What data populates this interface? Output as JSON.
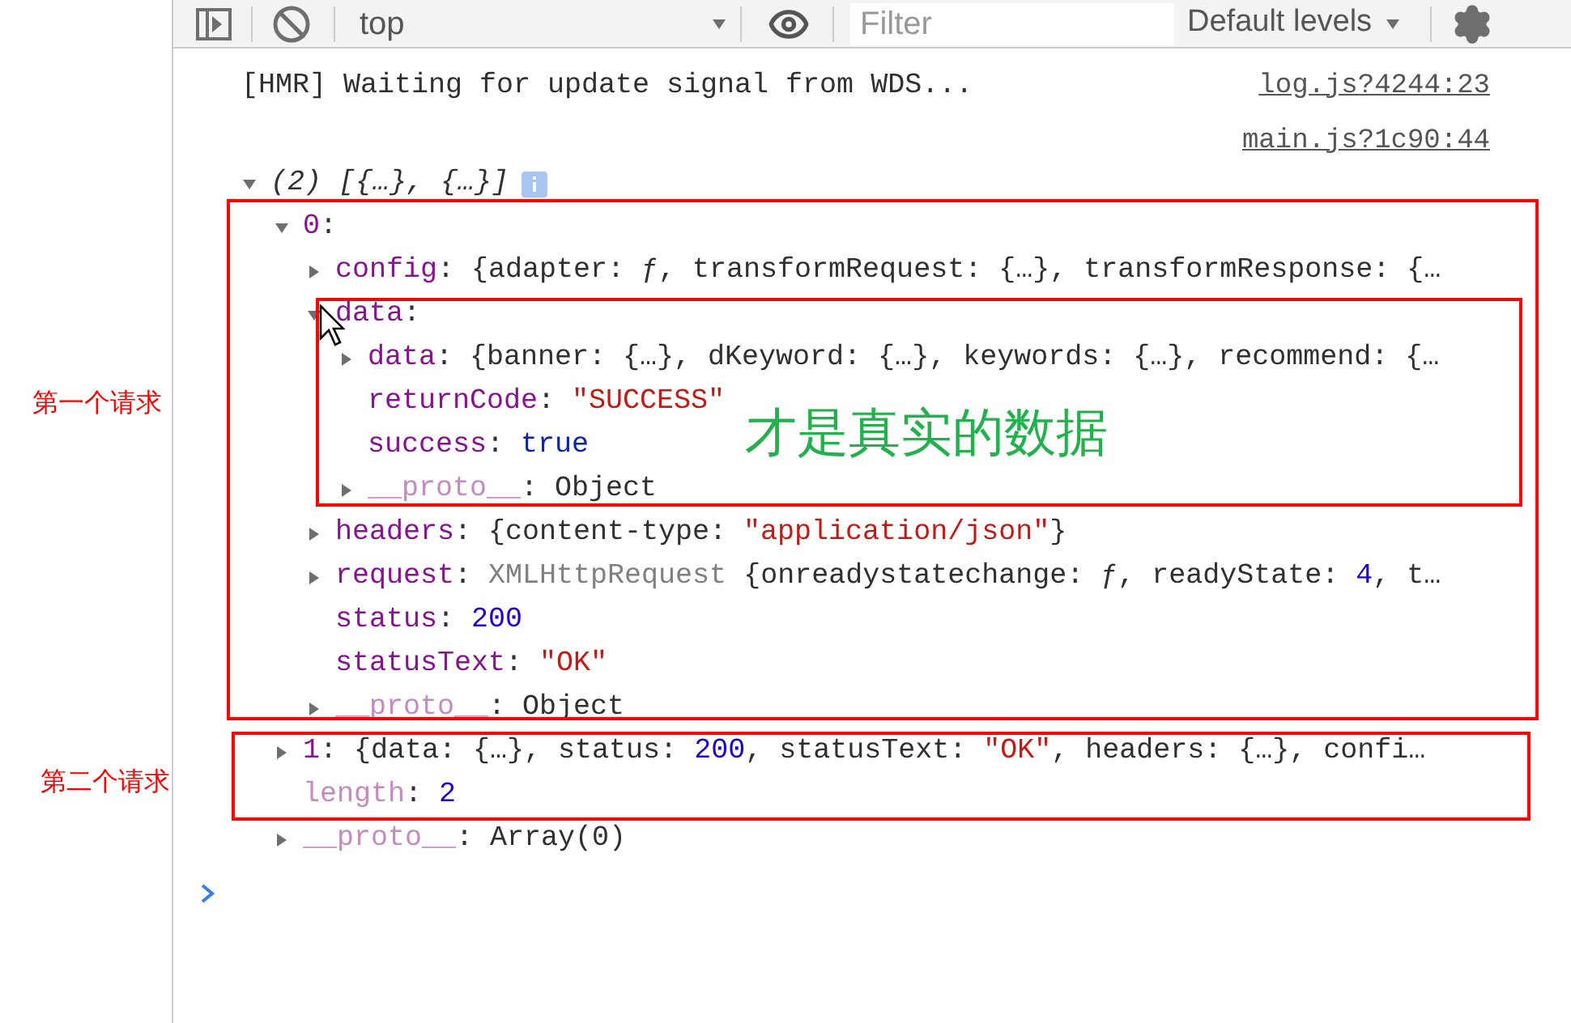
{
  "toolbar": {
    "context": "top",
    "filter": {
      "placeholder": "Filter"
    },
    "levels": "Default levels"
  },
  "messages": [
    {
      "kind": "log",
      "text": "[HMR] Waiting for update signal from WDS...",
      "source": "log.js?4244:23"
    },
    {
      "kind": "tree",
      "source": "main.js?1c90:44",
      "root": {
        "label": "(2) [{…}, {…}]",
        "expanded": true,
        "children": [
          {
            "kind": "object",
            "key": "0",
            "faded": false,
            "expanded": true,
            "value": [
              {
                "kind": "plain",
                "text": ":"
              }
            ],
            "children": [
              {
                "kind": "object",
                "key": "config",
                "faded": false,
                "expanded": false,
                "value": [
                  {
                    "kind": "plain",
                    "text": ": {adapter: ƒ, transformRequest: {…}, transformResponse: {…"
                  }
                ]
              },
              {
                "kind": "object",
                "key": "data",
                "faded": false,
                "expanded": true,
                "value": [
                  {
                    "kind": "plain",
                    "text": ":"
                  }
                ],
                "children": [
                  {
                    "kind": "object",
                    "key": "data",
                    "faded": false,
                    "expanded": false,
                    "value": [
                      {
                        "kind": "plain",
                        "text": ": {banner: {…}, dKeyword: {…}, keywords: {…}, recommend: {…"
                      }
                    ]
                  },
                  {
                    "kind": "leaf",
                    "key": "returnCode",
                    "faded": false,
                    "value": [
                      {
                        "kind": "plain",
                        "text": ": "
                      },
                      {
                        "kind": "string",
                        "text": "\"SUCCESS\""
                      }
                    ]
                  },
                  {
                    "kind": "leaf",
                    "key": "success",
                    "faded": false,
                    "value": [
                      {
                        "kind": "plain",
                        "text": ": "
                      },
                      {
                        "kind": "keyword",
                        "text": "true"
                      }
                    ]
                  },
                  {
                    "kind": "object",
                    "key": "__proto__",
                    "faded": true,
                    "expanded": false,
                    "value": [
                      {
                        "kind": "plain",
                        "text": ": Object"
                      }
                    ]
                  }
                ]
              },
              {
                "kind": "object",
                "key": "headers",
                "faded": false,
                "expanded": false,
                "value": [
                  {
                    "kind": "plain",
                    "text": ": {content-type: "
                  },
                  {
                    "kind": "string",
                    "text": "\"application/json\""
                  },
                  {
                    "kind": "plain",
                    "text": "}"
                  }
                ]
              },
              {
                "kind": "object",
                "key": "request",
                "faded": false,
                "expanded": false,
                "value": [
                  {
                    "kind": "plain",
                    "text": ": "
                  },
                  {
                    "kind": "type",
                    "text": "XMLHttpRequest "
                  },
                  {
                    "kind": "plain",
                    "text": "{onreadystatechange: ƒ, readyState: "
                  },
                  {
                    "kind": "number",
                    "text": "4"
                  },
                  {
                    "kind": "plain",
                    "text": ", t…"
                  }
                ]
              },
              {
                "kind": "leaf",
                "key": "status",
                "faded": false,
                "value": [
                  {
                    "kind": "plain",
                    "text": ": "
                  },
                  {
                    "kind": "number",
                    "text": "200"
                  }
                ]
              },
              {
                "kind": "leaf",
                "key": "statusText",
                "faded": false,
                "value": [
                  {
                    "kind": "plain",
                    "text": ": "
                  },
                  {
                    "kind": "string",
                    "text": "\"OK\""
                  }
                ]
              },
              {
                "kind": "object",
                "key": "__proto__",
                "faded": true,
                "expanded": false,
                "value": [
                  {
                    "kind": "plain",
                    "text": ": Object"
                  }
                ]
              }
            ]
          },
          {
            "kind": "object",
            "key": "1",
            "faded": false,
            "expanded": false,
            "value": [
              {
                "kind": "plain",
                "text": ": {data: {…}, status: "
              },
              {
                "kind": "number",
                "text": "200"
              },
              {
                "kind": "plain",
                "text": ", statusText: "
              },
              {
                "kind": "string",
                "text": "\"OK\""
              },
              {
                "kind": "plain",
                "text": ", headers: {…}, confi…"
              }
            ]
          },
          {
            "kind": "leaf",
            "key": "length",
            "faded": true,
            "value": [
              {
                "kind": "plain",
                "text": ": "
              },
              {
                "kind": "number",
                "text": "2"
              }
            ]
          },
          {
            "kind": "object",
            "key": "__proto__",
            "faded": true,
            "expanded": false,
            "value": [
              {
                "kind": "plain",
                "text": ": Array(0)"
              }
            ]
          }
        ]
      }
    }
  ],
  "annotations": [
    {
      "text": "第一个请求",
      "color": "#ff0000"
    },
    {
      "text": "第二个请求",
      "color": "#ff0000"
    },
    {
      "text": "才是真实的数据",
      "color": "#22b14c"
    }
  ]
}
